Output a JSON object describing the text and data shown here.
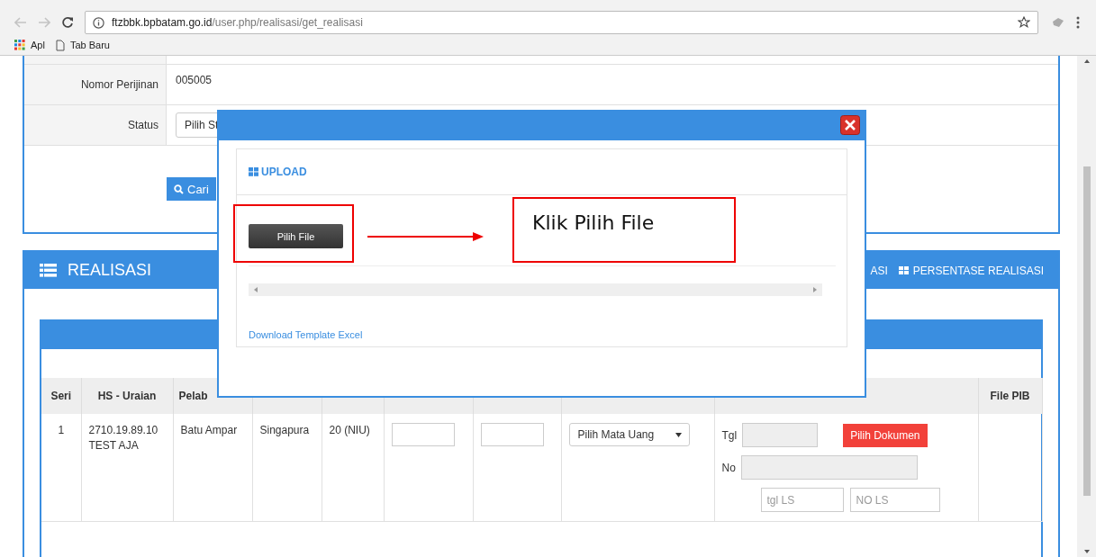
{
  "browser": {
    "url_host": "ftzbbk.bpbatam.go.id",
    "url_path": "/user.php/realisasi/get_realisasi",
    "bookmarks": [
      {
        "kind": "apps",
        "label": "Apl"
      },
      {
        "kind": "page",
        "label": "Tab Baru"
      }
    ]
  },
  "filter_form": {
    "fields": [
      {
        "kind": "text",
        "label": "Nomor Perijinan",
        "value": "005005"
      },
      {
        "kind": "select",
        "label": "Status",
        "value": "Pilih St"
      }
    ],
    "search_button": "Cari"
  },
  "realisasi_panel": {
    "title": "REALISASI",
    "tabs": [
      {
        "label": "ASI"
      },
      {
        "label": "PERSENTASE REALISASI"
      }
    ]
  },
  "table": {
    "columns": [
      {
        "label": "Seri"
      },
      {
        "label": "HS - Uraian"
      },
      {
        "label": "Pelab"
      },
      {},
      {},
      {},
      {},
      {},
      {},
      {
        "label": "File PIB"
      }
    ],
    "rows": [
      {
        "cells": [
          {
            "kind": "text",
            "lines": [
              "1"
            ]
          },
          {
            "kind": "text",
            "lines": [
              "2710.19.89.10",
              "TEST AJA"
            ]
          },
          {
            "kind": "text",
            "lines": [
              "Batu Ampar"
            ]
          },
          {
            "kind": "text",
            "lines": [
              "Singapura"
            ]
          },
          {
            "kind": "text",
            "lines": [
              "20 (NIU)"
            ]
          },
          {
            "kind": "input"
          },
          {
            "kind": "input"
          },
          {
            "kind": "select",
            "value": "Pilih Mata Uang"
          },
          {
            "kind": "document",
            "date_label": "Tgl",
            "button": "Pilih Dokumen",
            "number_label": "No",
            "placeholders": [
              "tgl LS",
              "NO LS"
            ]
          },
          {
            "kind": "empty"
          }
        ]
      }
    ]
  },
  "upload_dialog": {
    "section_title": "UPLOAD",
    "file_button": "Pilih File",
    "template_link": "Download Template Excel"
  },
  "annotation": {
    "text": "Klik Pilih File"
  }
}
